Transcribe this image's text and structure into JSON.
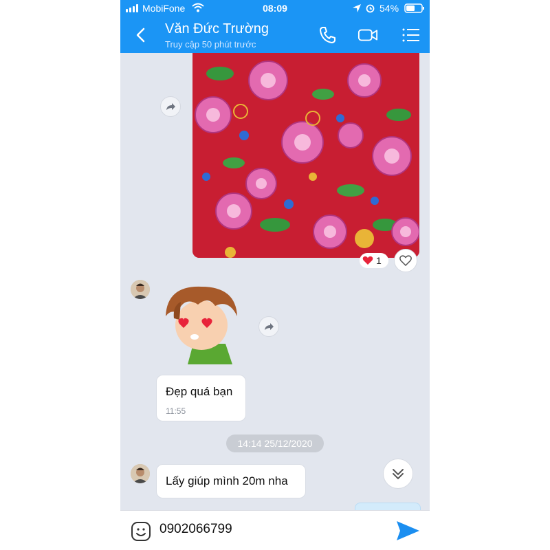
{
  "status_bar": {
    "carrier": "MobiFone",
    "time": "08:09",
    "battery": "54%"
  },
  "header": {
    "contact_name": "Văn Đức Trường",
    "contact_status": "Truy cập 50 phút trước"
  },
  "messages": {
    "image_reaction_count": "1",
    "text_1": {
      "text": "Đẹp quá bạn",
      "time": "11:55"
    },
    "date_separator": "14:14 25/12/2020",
    "text_2": {
      "text": "Lấy giúp mình 20m nha"
    }
  },
  "input": {
    "value": "0902066799"
  },
  "colors": {
    "header": "#1b95f5",
    "background": "#e2e6ee",
    "send": "#1b8ef0",
    "heart": "#e8233a"
  }
}
